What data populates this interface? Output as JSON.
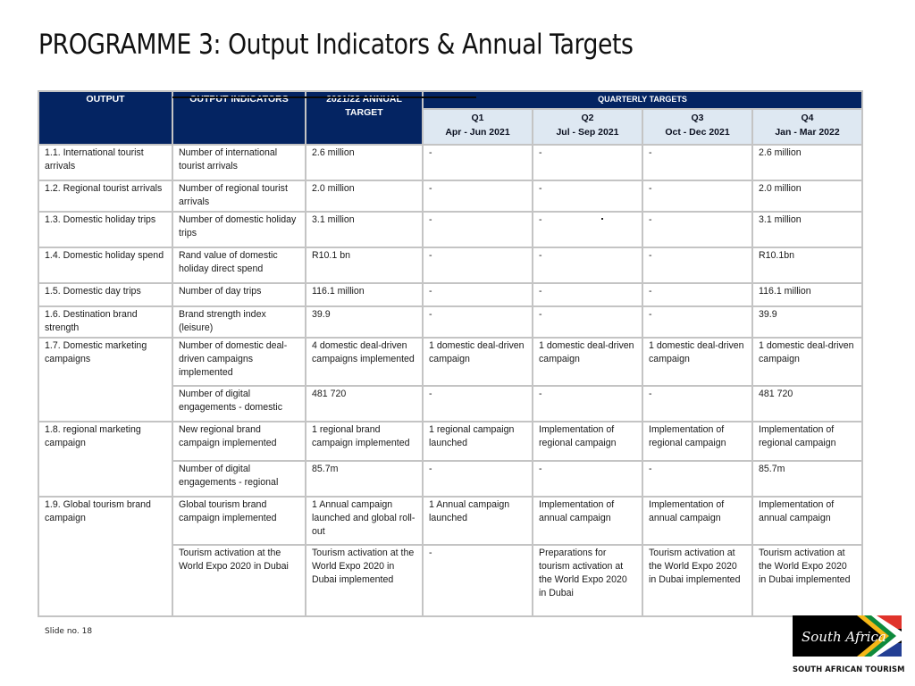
{
  "slide": {
    "title": "PROGRAMME 3: Output Indicators & Annual Targets",
    "footer": "Slide no. 18",
    "logo_text": "South Africa",
    "org_name": "SOUTH AFRICAN TOURISM"
  },
  "colors": {
    "header_dark": "#042462",
    "header_light": "#dee8f2",
    "grid": "#c4c4c4"
  },
  "table": {
    "headers": {
      "output": "OUTPUT",
      "indicators": "OUTPUT INDICATORS",
      "annual_target": "2021/22 ANNUAL TARGET",
      "quarterly": "QUARTERLY TARGETS",
      "q1": "Q1",
      "q1_period": "Apr - Jun 2021",
      "q2": "Q2",
      "q2_period": "Jul - Sep 2021",
      "q3": "Q3",
      "q3_period": "Oct - Dec 2021",
      "q4": "Q4",
      "q4_period": "Jan - Mar 2022"
    },
    "rows": [
      {
        "output": "1.1. International tourist arrivals",
        "indicator": "Number of international tourist arrivals",
        "annual": "2.6 million",
        "q1": "-",
        "q2": "-",
        "q3": "-",
        "q4": "2.6 million"
      },
      {
        "output": "1.2. Regional tourist arrivals",
        "indicator": "Number of regional tourist arrivals",
        "annual": "2.0 million",
        "q1": "-",
        "q2": "-",
        "q3": "-",
        "q4": "2.0 million"
      },
      {
        "output": "1.3. Domestic holiday trips",
        "indicator": "Number of domestic holiday trips",
        "annual": "3.1 million",
        "q1": "-",
        "q2": "-",
        "q3": "-",
        "q4": "3.1 million"
      },
      {
        "output": "1.4. Domestic holiday spend",
        "indicator": "Rand value of domestic holiday direct spend",
        "annual": "R10.1 bn",
        "q1": "-",
        "q2": "-",
        "q3": "-",
        "q4": "R10.1bn"
      },
      {
        "output": "1.5. Domestic day trips",
        "indicator": "Number of day trips",
        "annual": "116.1 million",
        "q1": "-",
        "q2": "-",
        "q3": "-",
        "q4": "116.1 million"
      },
      {
        "output": "1.6. Destination brand strength",
        "indicator": "Brand strength index (leisure)",
        "annual": "39.9",
        "q1": "-",
        "q2": "-",
        "q3": "-",
        "q4": "39.9"
      },
      {
        "output": "1.7. Domestic marketing campaigns",
        "indicator": "Number of domestic deal-driven campaigns implemented",
        "annual": "4 domestic deal-driven campaigns implemented",
        "q1": "1 domestic deal-driven campaign",
        "q2": "1 domestic deal-driven campaign",
        "q3": "1 domestic deal-driven campaign",
        "q4": "1 domestic deal-driven campaign"
      },
      {
        "output": "",
        "indicator": "Number of digital engagements - domestic",
        "annual": "481 720",
        "q1": "-",
        "q2": "-",
        "q3": "-",
        "q4": "481 720"
      },
      {
        "output": "1.8. regional marketing campaign",
        "indicator": "New regional brand campaign implemented",
        "annual": "1 regional brand campaign implemented",
        "q1": "1 regional campaign launched",
        "q2": "Implementation of regional campaign",
        "q3": "Implementation of regional campaign",
        "q4": "Implementation of regional campaign"
      },
      {
        "output": "",
        "indicator": "Number of digital engagements - regional",
        "annual": "85.7m",
        "q1": "-",
        "q2": "-",
        "q3": "-",
        "q4": "85.7m"
      },
      {
        "output": "1.9. Global tourism brand campaign",
        "indicator": "Global tourism brand campaign implemented",
        "annual": "1 Annual campaign launched and global roll-out",
        "q1": "1 Annual campaign launched",
        "q2": "Implementation of annual campaign",
        "q3": "Implementation of annual campaign",
        "q4": "Implementation of annual campaign"
      },
      {
        "output": "",
        "indicator": "Tourism activation at the World Expo 2020 in Dubai",
        "annual": "Tourism activation at the World Expo 2020 in Dubai implemented",
        "q1": "-",
        "q2": "Preparations for tourism activation at the World Expo 2020 in Dubai",
        "q3": "Tourism activation at the World Expo 2020 in Dubai implemented",
        "q4": "Tourism activation at the World Expo 2020 in Dubai implemented"
      }
    ]
  }
}
